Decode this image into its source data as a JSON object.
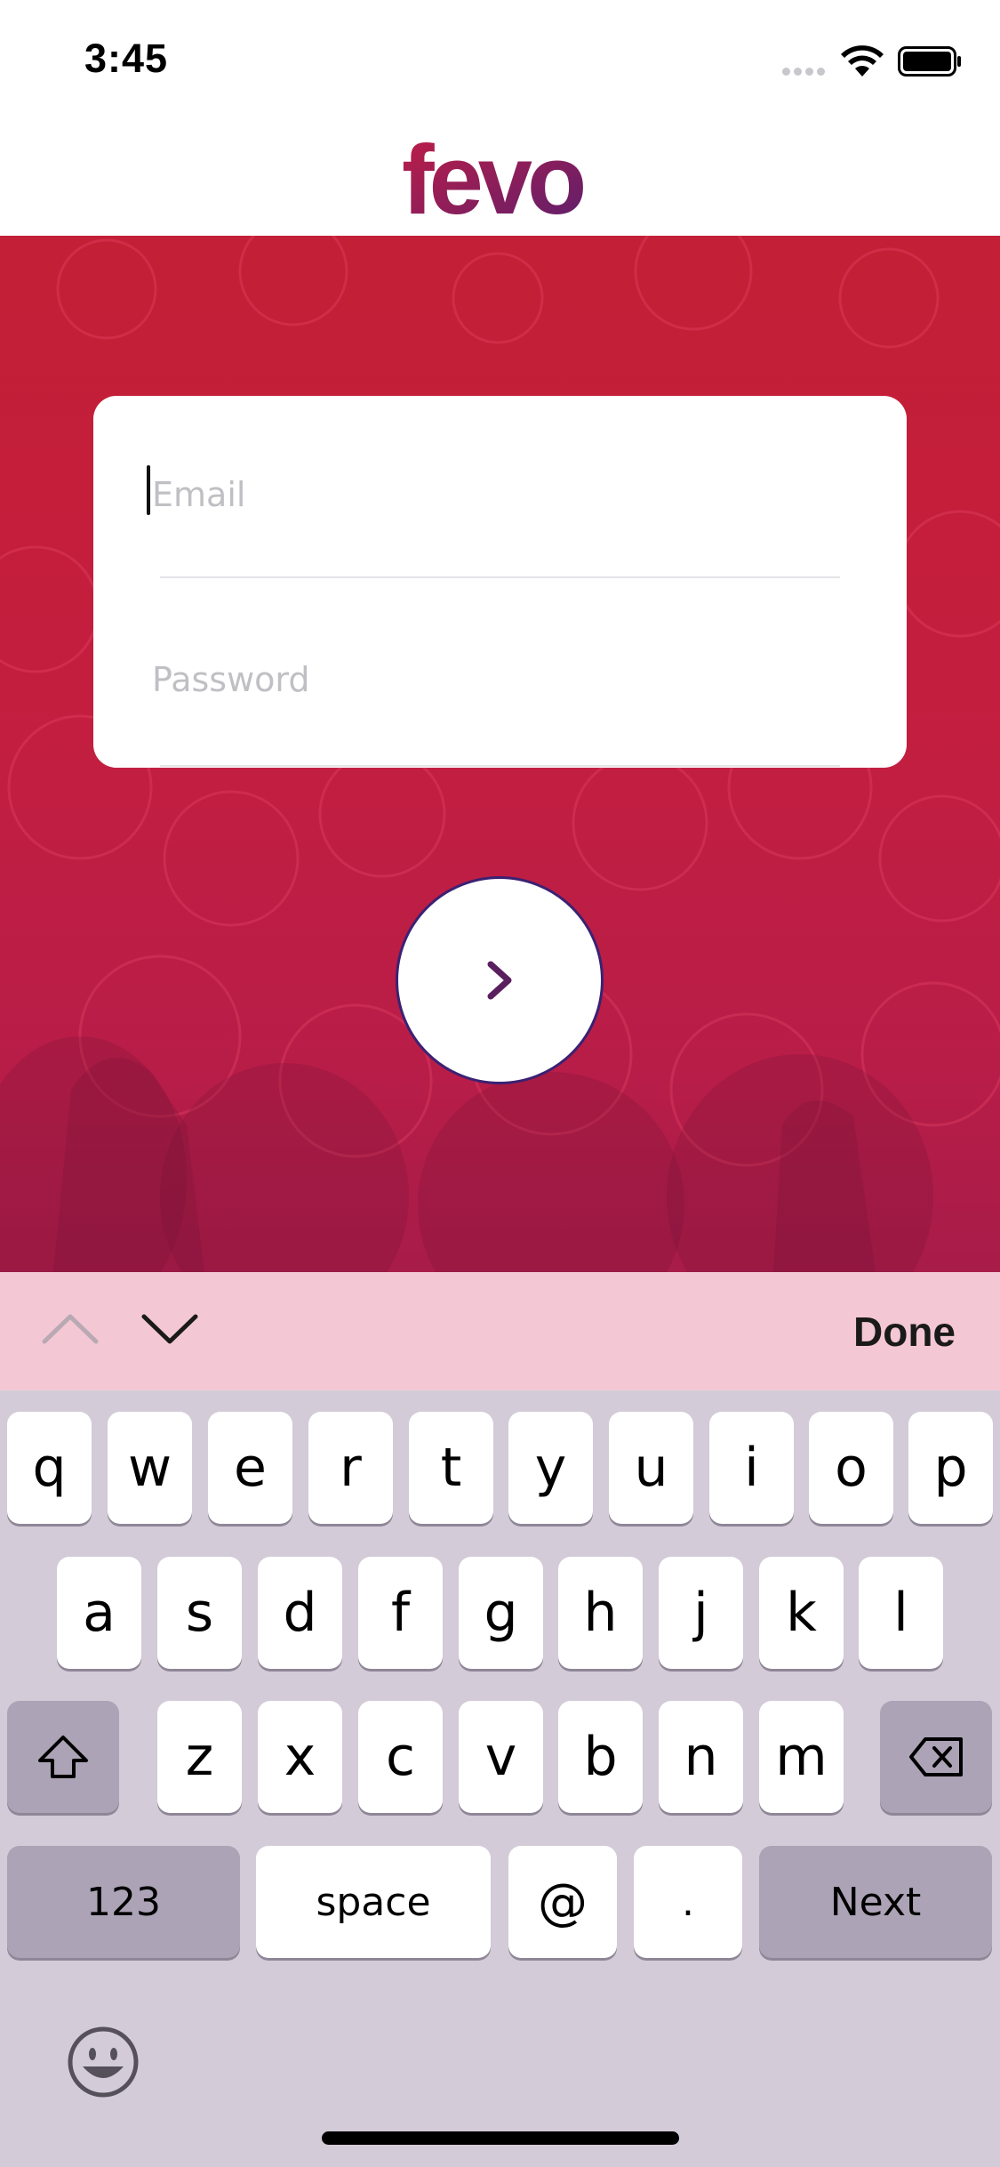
{
  "status_bar": {
    "time": "3:45"
  },
  "header": {
    "logo_text": "fevo",
    "logo_colors": [
      "#c21d45",
      "#5a1f6e"
    ]
  },
  "login": {
    "email_placeholder": "Email",
    "email_value": "",
    "password_placeholder": "Password",
    "password_value": "",
    "submit_icon": "chevron-right-icon"
  },
  "theme": {
    "hero_color": "#c41e3f",
    "accent": "#3b2173",
    "accessory_bar": "#f4c7d5"
  },
  "accessory_bar": {
    "prev_icon": "chevron-up-icon",
    "next_icon": "chevron-down-icon",
    "done_label": "Done"
  },
  "keyboard": {
    "row1": [
      "q",
      "w",
      "e",
      "r",
      "t",
      "y",
      "u",
      "i",
      "o",
      "p"
    ],
    "row2": [
      "a",
      "s",
      "d",
      "f",
      "g",
      "h",
      "j",
      "k",
      "l"
    ],
    "row3": [
      "z",
      "x",
      "c",
      "v",
      "b",
      "n",
      "m"
    ],
    "numbers_label": "123",
    "space_label": "space",
    "at_label": "@",
    "dot_label": ".",
    "next_label": "Next",
    "shift_icon": "shift-icon",
    "delete_icon": "backspace-icon",
    "emoji_icon": "emoji-icon"
  }
}
